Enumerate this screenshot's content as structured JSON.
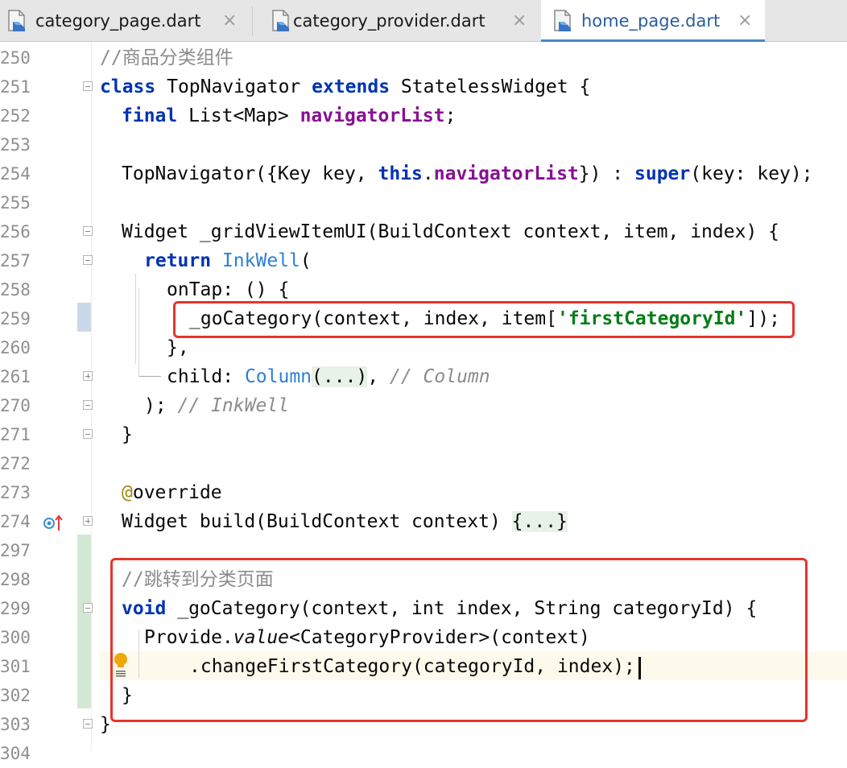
{
  "tabs": [
    {
      "label": "category_page.dart",
      "close": "×",
      "active": false
    },
    {
      "label": "category_provider.dart",
      "close": "×",
      "active": false
    },
    {
      "label": "home_page.dart",
      "close": "×",
      "active": true
    }
  ],
  "editor": {
    "lines": {
      "l250": {
        "num": "250",
        "comment": "//商品分类组件"
      },
      "l251": {
        "num": "251",
        "kw_class": "class",
        "name": " TopNavigator ",
        "kw_extends": "extends",
        "rest": " StatelessWidget {"
      },
      "l252": {
        "num": "252",
        "kw_final": "final",
        "type": " List<Map> ",
        "field": "navigatorList",
        "end": ";"
      },
      "l253": {
        "num": "253"
      },
      "l254": {
        "num": "254",
        "pre": "TopNavigator({Key key, ",
        "kw_this": "this",
        "dot": ".",
        "field": "navigatorList",
        "mid": "}) : ",
        "kw_super": "super",
        "end": "(key: key);"
      },
      "l255": {
        "num": "255"
      },
      "l256": {
        "num": "256",
        "text": "Widget _gridViewItemUI(BuildContext context, item, index) {"
      },
      "l257": {
        "num": "257",
        "kw_return": "return",
        "cls": "InkWell",
        "end": "("
      },
      "l258": {
        "num": "258",
        "text": "onTap: () {"
      },
      "l259": {
        "num": "259",
        "pre": "_goCategory(context, index, item[",
        "str": "'firstCategoryId'",
        "end": "]);"
      },
      "l260": {
        "num": "260",
        "text": "},"
      },
      "l261": {
        "num": "261",
        "pre": "child: ",
        "cls": "Column",
        "folded": "(...)",
        "mid": ", ",
        "comment": "// Column"
      },
      "l270": {
        "num": "270",
        "pre": "); ",
        "comment": "// InkWell"
      },
      "l271": {
        "num": "271",
        "text": "}"
      },
      "l272": {
        "num": "272"
      },
      "l273": {
        "num": "273",
        "at": "@",
        "text": "override"
      },
      "l274": {
        "num": "274",
        "pre": "Widget build(BuildContext context) ",
        "folded": "{...}"
      },
      "l297": {
        "num": "297"
      },
      "l298": {
        "num": "298",
        "comment": "//跳转到分类页面"
      },
      "l299": {
        "num": "299",
        "kw_void": "void",
        "rest": " _goCategory(context, int index, String categoryId) {"
      },
      "l300": {
        "num": "300",
        "pre": "Provide.",
        "ital": "value",
        "rest": "<CategoryProvider>(context)"
      },
      "l301": {
        "num": "301",
        "text": ".changeFirstCategory(categoryId, index);"
      },
      "l302": {
        "num": "302",
        "text": "}"
      },
      "l303": {
        "num": "303",
        "text": "}"
      },
      "l304": {
        "num": "304"
      }
    }
  },
  "colors": {
    "keyword": "#0033b3",
    "field": "#871094",
    "string": "#067d17",
    "comment": "#8c8c8c",
    "class_ref": "#2d7fd7",
    "annotation_box": "#e8342c",
    "active_tab_accent": "#4a86c8"
  },
  "icons": [
    "dart-file-icon",
    "close-icon",
    "fold-icon",
    "lightbulb-icon",
    "override-marker-icon"
  ]
}
